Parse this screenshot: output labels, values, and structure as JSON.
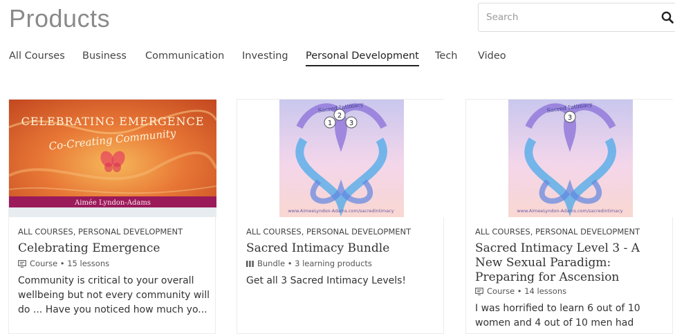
{
  "header": {
    "title": "Products"
  },
  "search": {
    "placeholder": "Search",
    "icon": "search-icon"
  },
  "tabs": [
    {
      "label": "All Courses",
      "active": false
    },
    {
      "label": "Business",
      "active": false
    },
    {
      "label": "Communication",
      "active": false
    },
    {
      "label": "Investing",
      "active": false
    },
    {
      "label": "Personal Development",
      "active": true
    },
    {
      "label": "Tech",
      "active": false
    },
    {
      "label": "Video",
      "active": false
    }
  ],
  "cards": [
    {
      "category": "ALL COURSES, PERSONAL DEVELOPMENT",
      "title": "Celebrating Emergence",
      "meta": "Course • 15 lessons",
      "meta_icon": "course-icon",
      "description": "Community is critical to your overall wellbeing but not every community will do ... Have you noticed how much yo...",
      "thumb": {
        "heading": "CELEBRATING EMERGENCE",
        "subheading": "Co-Creating Community",
        "author": "Aimée Lyndon-Adams"
      }
    },
    {
      "category": "ALL COURSES, PERSONAL DEVELOPMENT",
      "title": "Sacred Intimacy Bundle",
      "meta": "Bundle • 3 learning products",
      "meta_icon": "bundle-icon",
      "description": "Get all 3 Sacred Intimacy Levels!",
      "thumb": {
        "banner": "Sacred Intimacy",
        "levels": [
          "1",
          "2",
          "3"
        ],
        "url": "www.AimeeLyndon-Adams.com/sacredintimacy"
      }
    },
    {
      "category": "ALL COURSES, PERSONAL DEVELOPMENT",
      "title": "Sacred Intimacy Level 3 - A New Sexual Paradigm: Preparing for Ascension",
      "meta": "Course • 14 lessons",
      "meta_icon": "course-icon",
      "description": "I was horrified to learn 6 out of 10 women and 4 out of 10 men had",
      "thumb": {
        "banner": "Sacred Intimacy",
        "levels": [
          "3"
        ],
        "url": "www.AimeeLyndon-Adams.com/sacredintimacy"
      }
    }
  ]
}
